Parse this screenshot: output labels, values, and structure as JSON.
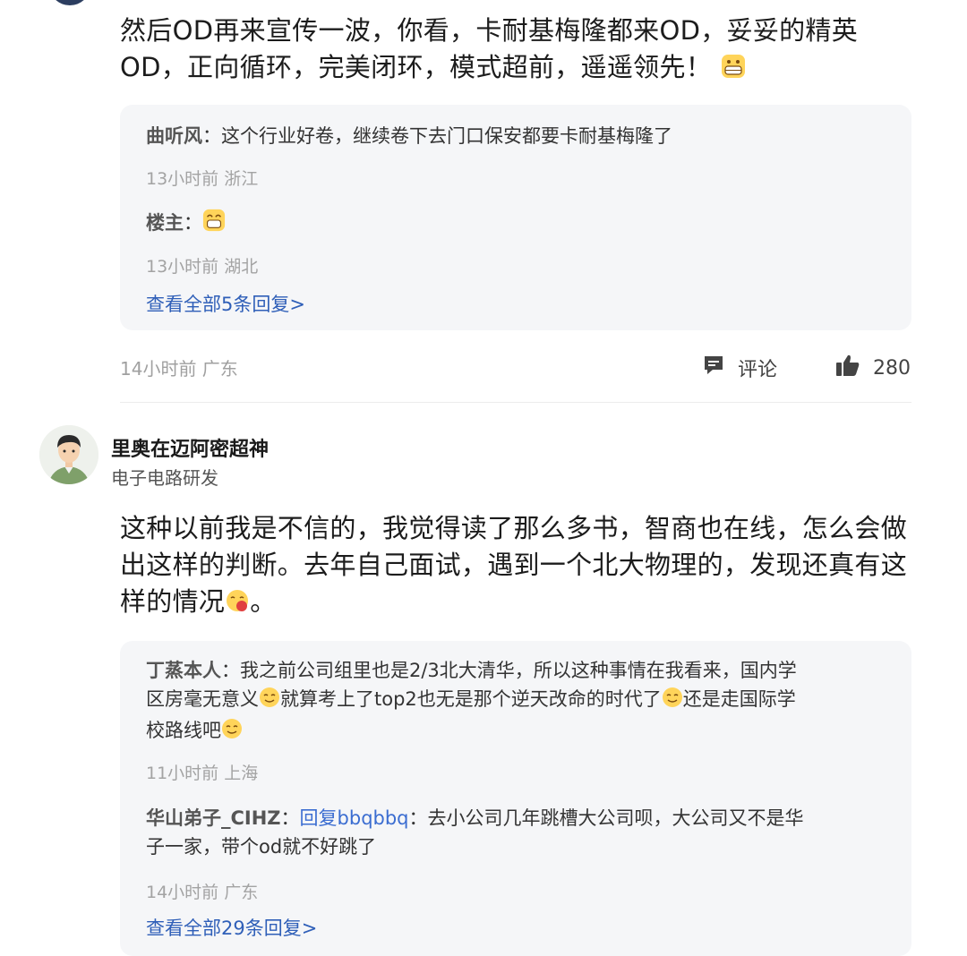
{
  "comment1": {
    "text_line1": "然后OD再来宣传一波，你看，卡耐基梅隆都来OD，妥妥的精英",
    "text_line2": "OD，正向循环，完美闭环，模式超前，遥遥领先！",
    "replies": [
      {
        "author": "曲听风",
        "sep": "：",
        "text": "这个行业好卷，继续卷下去门口保安都要卡耐基梅隆了",
        "meta": "13小时前 浙江"
      },
      {
        "author": "楼主",
        "sep": "：",
        "text": "",
        "meta": "13小时前 湖北"
      }
    ],
    "view_all": "查看全部5条回复>",
    "meta": "14小时前 广东",
    "comment_label": "评论",
    "like_count": "280"
  },
  "comment2": {
    "username": "里奥在迈阿密超神",
    "user_title": "电子电路研发",
    "text_line1": "这种以前我是不信的，我觉得读了那么多书，智商也在线，怎么会做",
    "text_line2": "出这样的判断。去年自己面试，遇到一个北大物理的，发现还真有这",
    "text_line3a": "样的情况",
    "text_line3b": "。",
    "replies": [
      {
        "author": "丁蒸本人",
        "sep": "：",
        "line1": "我之前公司组里也是2/3北大清华，所以这种事情在我看来，国内学",
        "line2a": "区房毫无意义",
        "line2b": "就算考上了top2也无是那个逆天改命的时代了",
        "line2c": "还是走国际学",
        "line3": "校路线吧",
        "meta": "11小时前 上海"
      },
      {
        "author": "华山弟子_CIHZ",
        "sep": "：",
        "reply_to": "回复bbqbbq",
        "sep2": "：",
        "line1": "去小公司几年跳槽大公司呗，大公司又不是华",
        "line2": "子一家，带个od就不好跳了",
        "meta": "14小时前 广东"
      }
    ],
    "view_all": "查看全部29条回复>"
  },
  "icons": {
    "comment": "comment-icon",
    "like": "thumbs-up-icon",
    "grin_emoji": "grin-emoji-icon",
    "cover_mouth_emoji": "cover-mouth-emoji-icon",
    "sweat_smile_emoji": "sweat-smile-emoji-icon"
  },
  "colors": {
    "link": "#3b6dd1",
    "view_all": "#2f5fb8",
    "reply_bg": "#f5f6f8",
    "meta": "#a0a0a0"
  }
}
